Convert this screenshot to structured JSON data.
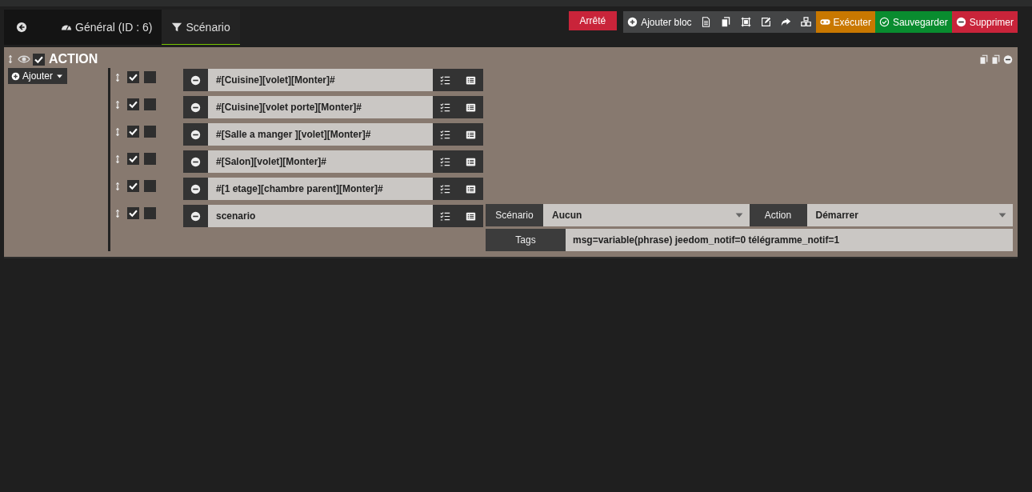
{
  "tabs": [
    {
      "label": "Général (ID : 6)",
      "selected": false
    },
    {
      "label": "Scénario",
      "selected": true
    }
  ],
  "state_badge": {
    "label": "Arrêté",
    "active": false
  },
  "toolbar": [
    {
      "kind": "plain",
      "label": "Ajouter bloc"
    },
    {
      "kind": "warning",
      "label": "Exécuter"
    },
    {
      "kind": "success",
      "label": "Sauvegarder"
    },
    {
      "kind": "danger",
      "label": "Supprimer"
    }
  ],
  "block": {
    "title": "ACTION",
    "visible": true,
    "enabled": true,
    "add_label": "Ajouter",
    "actions": [
      {
        "kind": "command",
        "enabled": true,
        "background": false,
        "command": "#[Cuisine][volet][Monter]#"
      },
      {
        "kind": "command",
        "enabled": true,
        "background": false,
        "command": "#[Cuisine][volet porte][Monter]#"
      },
      {
        "kind": "command",
        "enabled": true,
        "background": false,
        "command": "#[Salle a manger ][volet][Monter]#"
      },
      {
        "kind": "command",
        "enabled": true,
        "background": false,
        "command": "#[Salon][volet][Monter]#"
      },
      {
        "kind": "command",
        "enabled": true,
        "background": false,
        "command": "#[1 etage][chambre parent][Monter]#"
      },
      {
        "kind": "scenario",
        "enabled": true,
        "background": false,
        "command": "scenario",
        "options": {
          "scenario_label": "Scénario",
          "scenario_value": "Aucun",
          "action_label": "Action",
          "action_value": "Démarrer",
          "tags_label": "Tags",
          "tags_value": "msg=variable(phrase) jeedom_notif=0 télégramme_notif=1"
        }
      }
    ]
  }
}
